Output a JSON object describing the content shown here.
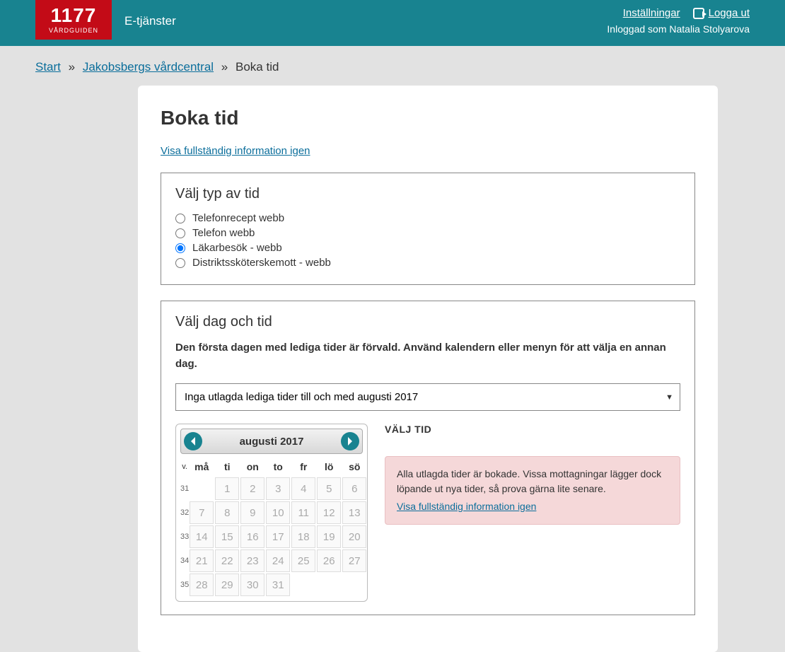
{
  "header": {
    "logo_number": "1177",
    "logo_sub": "VÅRDGUIDEN",
    "title": "E-tjänster",
    "settings": "Inställningar",
    "logout": "Logga ut",
    "logged_in_prefix": "Inloggad som ",
    "user_name": "Natalia Stolyarova"
  },
  "breadcrumb": {
    "start": "Start",
    "sep": "»",
    "center": "Jakobsbergs vårdcentral",
    "current": "Boka tid"
  },
  "page": {
    "title": "Boka tid",
    "show_full_info": "Visa fullständig information igen"
  },
  "type_box": {
    "title": "Välj typ av tid",
    "options": [
      {
        "label": "Telefonrecept webb",
        "checked": false
      },
      {
        "label": "Telefon webb",
        "checked": false
      },
      {
        "label": "Läkarbesök - webb",
        "checked": true
      },
      {
        "label": "Distriktssköterskemott - webb",
        "checked": false
      }
    ]
  },
  "daytime_box": {
    "title": "Välj dag och tid",
    "instruction": "Den första dagen med lediga tider är förvald. Använd kalendern eller menyn för att välja en annan dag.",
    "select_value": "Inga utlagda lediga tider till och med augusti 2017"
  },
  "calendar": {
    "month": "augusti 2017",
    "week_header": "v.",
    "day_headers": [
      "må",
      "ti",
      "on",
      "to",
      "fr",
      "lö",
      "sö"
    ],
    "weeks": [
      {
        "wk": "31",
        "days": [
          "",
          "1",
          "2",
          "3",
          "4",
          "5",
          "6"
        ]
      },
      {
        "wk": "32",
        "days": [
          "7",
          "8",
          "9",
          "10",
          "11",
          "12",
          "13"
        ]
      },
      {
        "wk": "33",
        "days": [
          "14",
          "15",
          "16",
          "17",
          "18",
          "19",
          "20"
        ]
      },
      {
        "wk": "34",
        "days": [
          "21",
          "22",
          "23",
          "24",
          "25",
          "26",
          "27"
        ]
      },
      {
        "wk": "35",
        "days": [
          "28",
          "29",
          "30",
          "31",
          "",
          "",
          ""
        ]
      }
    ]
  },
  "side": {
    "title": "VÄLJ TID",
    "alert_text": "Alla utlagda tider är bokade. Vissa mottagningar lägger dock löpande ut nya tider, så prova gärna lite senare.",
    "alert_link": "Visa fullständig information igen"
  }
}
